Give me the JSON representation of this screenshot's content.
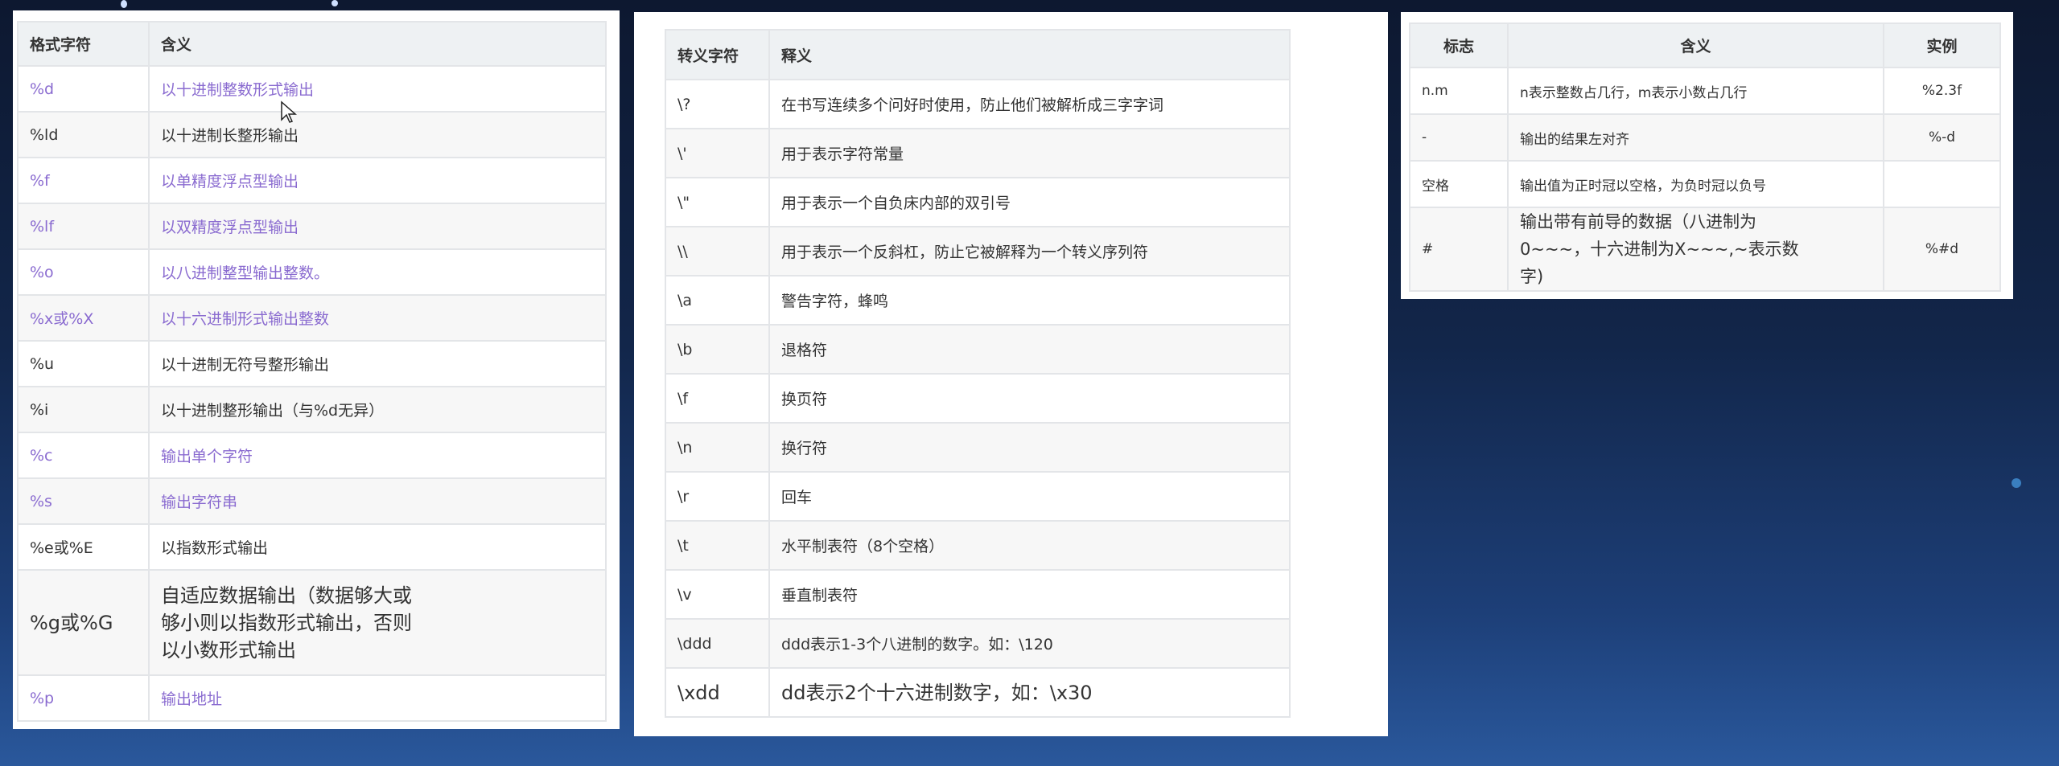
{
  "format_table": {
    "headers": [
      "格式字符",
      "含义"
    ],
    "rows": [
      {
        "code": "%d",
        "meaning": "以十进制整数形式输出",
        "link": true
      },
      {
        "code": "%ld",
        "meaning": "以十进制长整形输出",
        "link": false
      },
      {
        "code": "%f",
        "meaning": "以单精度浮点型输出",
        "link": true
      },
      {
        "code": "%lf",
        "meaning": "以双精度浮点型输出",
        "link": true
      },
      {
        "code": "%o",
        "meaning": "以八进制整型输出整数。",
        "link": true
      },
      {
        "code": "%x或%X",
        "meaning": "以十六进制形式输出整数",
        "link": true
      },
      {
        "code": "%u",
        "meaning": "以十进制无符号整形输出",
        "link": false
      },
      {
        "code": "%i",
        "meaning": "以十进制整形输出（与%d无异）",
        "link": false
      },
      {
        "code": "%c",
        "meaning": "输出单个字符",
        "link": true
      },
      {
        "code": "%s",
        "meaning": "输出字符串",
        "link": true
      },
      {
        "code": "%e或%E",
        "meaning": "以指数形式输出",
        "link": false
      },
      {
        "code": "%g或%G",
        "meaning": "自适应数据输出（数据够大或够小则以指数形式输出，否则以小数形式输出",
        "link": false,
        "big": true
      },
      {
        "code": "%p",
        "meaning": "输出地址",
        "link": true
      }
    ]
  },
  "escape_table": {
    "headers": [
      "转义字符",
      "释义"
    ],
    "rows": [
      {
        "code": "\\?",
        "meaning": "在书写连续多个问好时使用，防止他们被解析成三字字词"
      },
      {
        "code": "\\'",
        "meaning": "用于表示字符常量"
      },
      {
        "code": "\\\"",
        "meaning": "用于表示一个自负床内部的双引号"
      },
      {
        "code": "\\\\",
        "meaning": "用于表示一个反斜杠，防止它被解释为一个转义序列符"
      },
      {
        "code": "\\a",
        "meaning": "警告字符，蜂鸣"
      },
      {
        "code": "\\b",
        "meaning": "退格符"
      },
      {
        "code": "\\f",
        "meaning": "换页符"
      },
      {
        "code": "\\n",
        "meaning": "换行符"
      },
      {
        "code": "\\r",
        "meaning": "回车"
      },
      {
        "code": "\\t",
        "meaning": "水平制表符（8个空格）"
      },
      {
        "code": "\\v",
        "meaning": "垂直制表符"
      },
      {
        "code": "\\ddd",
        "meaning": "ddd表示1-3个八进制的数字。如：\\120"
      },
      {
        "code": "\\xdd",
        "meaning": "dd表示2个十六进制数字，如：\\x30",
        "big": true
      }
    ]
  },
  "flag_table": {
    "headers": [
      "标志",
      "含义",
      "实例"
    ],
    "rows": [
      {
        "flag": "n.m",
        "meaning": "n表示整数占几行，m表示小数占几行",
        "example": "%2.3f"
      },
      {
        "flag": "-",
        "meaning": "输出的结果左对齐",
        "example": "%-d"
      },
      {
        "flag": "空格",
        "meaning": "输出值为正时冠以空格，为负时冠以负号",
        "example": ""
      },
      {
        "flag": "#",
        "meaning": "输出带有前导的数据（八进制为0~~~，十六进制为X~~~,~表示数字)",
        "example": "%#d",
        "big": true
      }
    ]
  },
  "colors": {
    "link": "#8a6bd0",
    "header_bg": "#eef1f3",
    "alt_row": "#f7f7f7"
  }
}
